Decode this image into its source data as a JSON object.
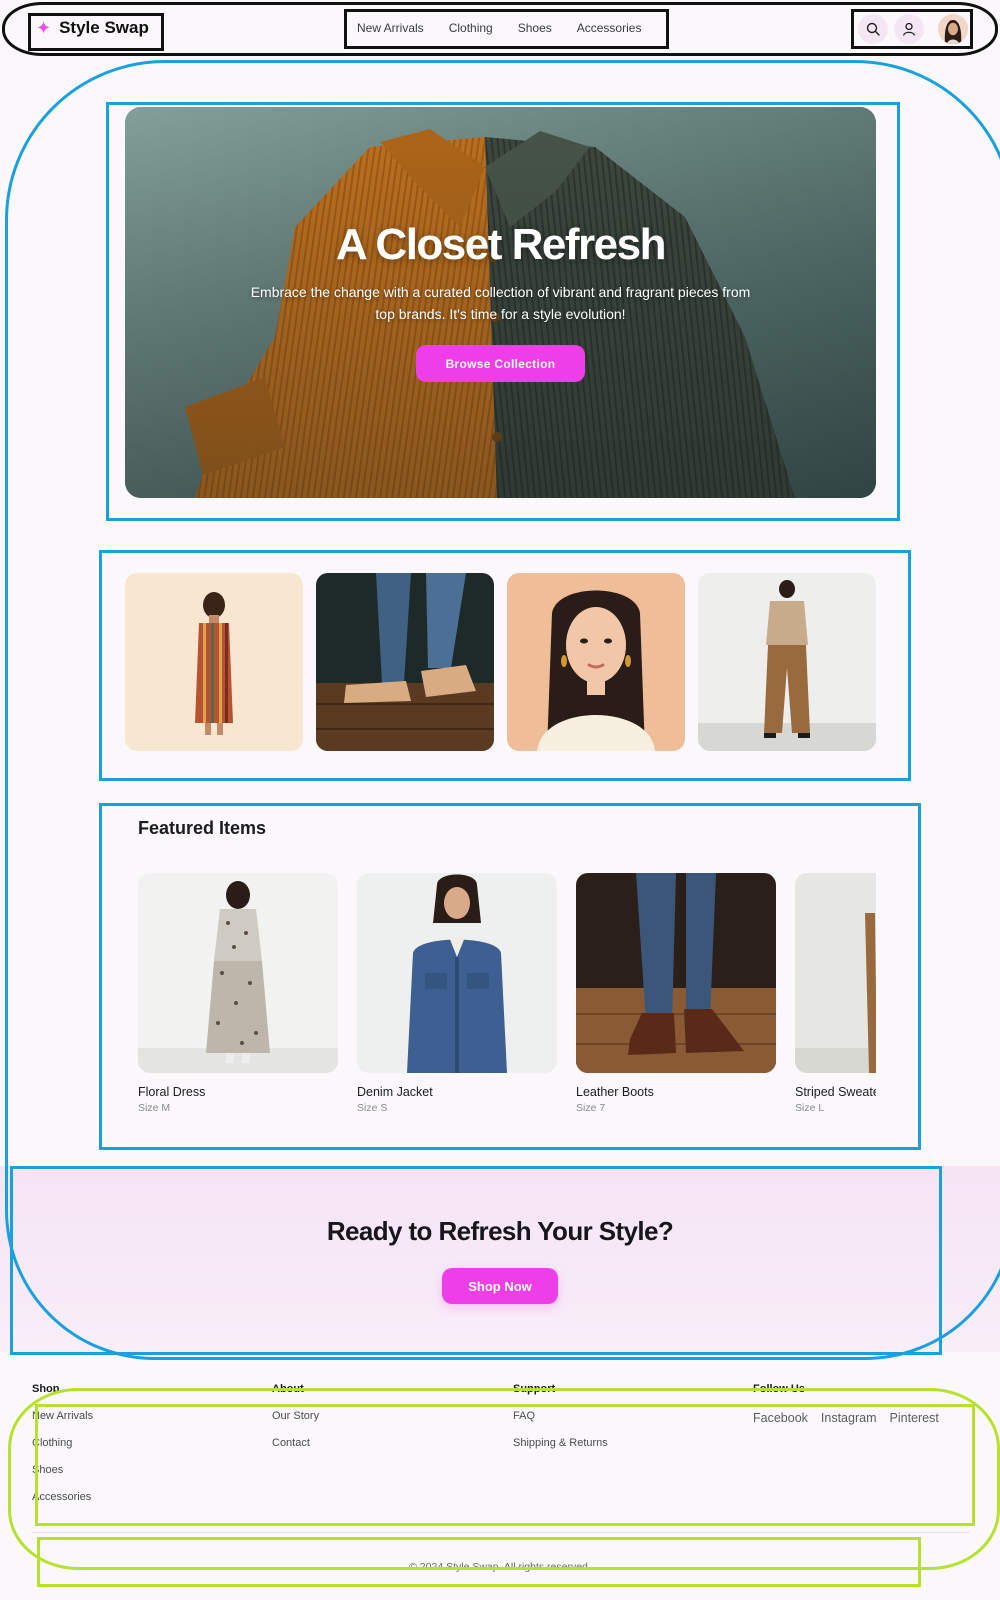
{
  "header": {
    "brand": "Style Swap",
    "nav": [
      "New Arrivals",
      "Clothing",
      "Shoes",
      "Accessories"
    ]
  },
  "hero": {
    "title": "A Closet Refresh",
    "subtitle": "Embrace the change with a curated collection of vibrant and fragrant pieces from top brands. It's time for a style evolution!",
    "button": "Browse Collection"
  },
  "featured": {
    "title": "Featured Items",
    "items": [
      {
        "name": "Floral Dress",
        "size": "Size M"
      },
      {
        "name": "Denim Jacket",
        "size": "Size S"
      },
      {
        "name": "Leather Boots",
        "size": "Size 7"
      },
      {
        "name": "Striped Sweater",
        "size": "Size L"
      }
    ]
  },
  "cta": {
    "title": "Ready to Refresh Your Style?",
    "button": "Shop Now"
  },
  "footer": {
    "columns": [
      {
        "heading": "Shop",
        "links": [
          "New Arrivals",
          "Clothing",
          "Shoes",
          "Accessories"
        ]
      },
      {
        "heading": "About",
        "links": [
          "Our Story",
          "Contact"
        ]
      },
      {
        "heading": "Support",
        "links": [
          "FAQ",
          "Shipping & Returns"
        ]
      },
      {
        "heading": "Follow Us",
        "links": []
      }
    ],
    "social": [
      "Facebook",
      "Instagram",
      "Pinterest"
    ],
    "copyright": "© 2024 Style Swap. All rights reserved."
  },
  "colors": {
    "accent": "#ee3ee8",
    "cta_background": "#f6e4f5",
    "page_background": "#faf8fb"
  },
  "icons": [
    "sparkle-icon",
    "search-icon",
    "user-icon",
    "avatar"
  ]
}
